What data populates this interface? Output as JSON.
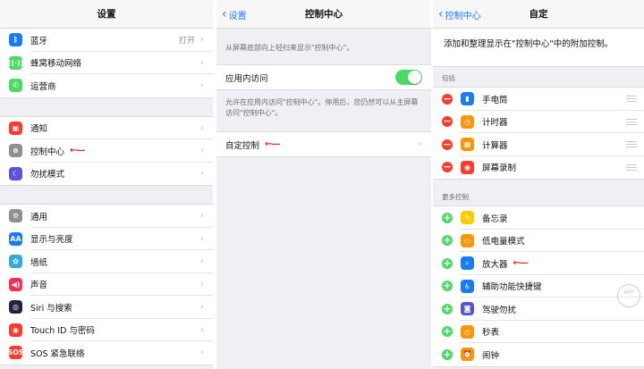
{
  "screen1": {
    "title": "设置",
    "group1": [
      {
        "label": "蓝牙",
        "value": "打开",
        "icon": "bluetooth-icon",
        "color": "#1a7cf5",
        "glyph": "ᛒ"
      },
      {
        "label": "蜂窝移动网络",
        "icon": "cellular-icon",
        "color": "#4cd964",
        "glyph": "((·))"
      },
      {
        "label": "运营商",
        "icon": "phone-icon",
        "color": "#4cd964",
        "glyph": "✆"
      }
    ],
    "group2": [
      {
        "label": "通知",
        "icon": "notification-icon",
        "color": "#ff3b30",
        "glyph": "▣"
      },
      {
        "label": "控制中心",
        "icon": "control-center-icon",
        "color": "#8e8e93",
        "glyph": "⊜",
        "arrow": "←—"
      },
      {
        "label": "勿扰模式",
        "icon": "moon-icon",
        "color": "#5856d6",
        "glyph": "☾"
      }
    ],
    "group3": [
      {
        "label": "通用",
        "icon": "gear-icon",
        "color": "#8e8e93",
        "glyph": "⚙"
      },
      {
        "label": "显示与亮度",
        "icon": "display-icon",
        "color": "#1a7cf5",
        "glyph": "AA"
      },
      {
        "label": "墙纸",
        "icon": "wallpaper-icon",
        "color": "#34aadc",
        "glyph": "✿"
      },
      {
        "label": "声音",
        "icon": "sound-icon",
        "color": "#ff2d55",
        "glyph": "◀)"
      },
      {
        "label": "Siri 与搜索",
        "icon": "siri-icon",
        "color": "#222244",
        "glyph": "◎"
      },
      {
        "label": "Touch ID 与密码",
        "icon": "fingerprint-icon",
        "color": "#ff3b30",
        "glyph": "◉"
      },
      {
        "label": "SOS 紧急联络",
        "icon": "sos-icon",
        "color": "#ff3b30",
        "glyph": "SOS"
      }
    ]
  },
  "screen2": {
    "back": "设置",
    "title": "控制中心",
    "hint1": "从屏幕底部向上轻扫来显示\"控制中心\"。",
    "toggle_label": "应用内访问",
    "toggle_on": true,
    "hint2": "允许在应用内访问\"控制中心\"。停用后，您仍然可以从主屏幕访问\"控制中心\"。",
    "customize_label": "自定控制",
    "customize_arrow": "←—"
  },
  "screen3": {
    "back": "控制中心",
    "title": "自定",
    "intro": "添加和整理显示在\"控制中心\"中的附加控制。",
    "include_header": "包括",
    "included": [
      {
        "label": "手电筒",
        "icon": "flashlight-icon",
        "color": "#1a7cf5",
        "glyph": "▮"
      },
      {
        "label": "计时器",
        "icon": "timer-icon",
        "color": "#ff9500",
        "glyph": "◷"
      },
      {
        "label": "计算器",
        "icon": "calculator-icon",
        "color": "#ff9500",
        "glyph": "▦"
      },
      {
        "label": "屏幕录制",
        "icon": "screen-record-icon",
        "color": "#ff3b30",
        "glyph": "◉"
      }
    ],
    "more_header": "更多控制",
    "more": [
      {
        "label": "备忘录",
        "icon": "notes-icon",
        "color": "#ffcc00",
        "glyph": "✎"
      },
      {
        "label": "低电量模式",
        "icon": "battery-icon",
        "color": "#ff9500",
        "glyph": "▭"
      },
      {
        "label": "放大器",
        "icon": "magnifier-icon",
        "color": "#1a7cf5",
        "glyph": "⌕",
        "arrow": "←—"
      },
      {
        "label": "辅助功能快捷键",
        "icon": "accessibility-icon",
        "color": "#1a7cf5",
        "glyph": "♿"
      },
      {
        "label": "驾驶勿扰",
        "icon": "car-icon",
        "color": "#5856d6",
        "glyph": "◙"
      },
      {
        "label": "秒表",
        "icon": "stopwatch-icon",
        "color": "#ff9500",
        "glyph": "◴"
      },
      {
        "label": "闹钟",
        "icon": "alarm-icon",
        "color": "#ff9500",
        "glyph": "⏰"
      }
    ]
  }
}
